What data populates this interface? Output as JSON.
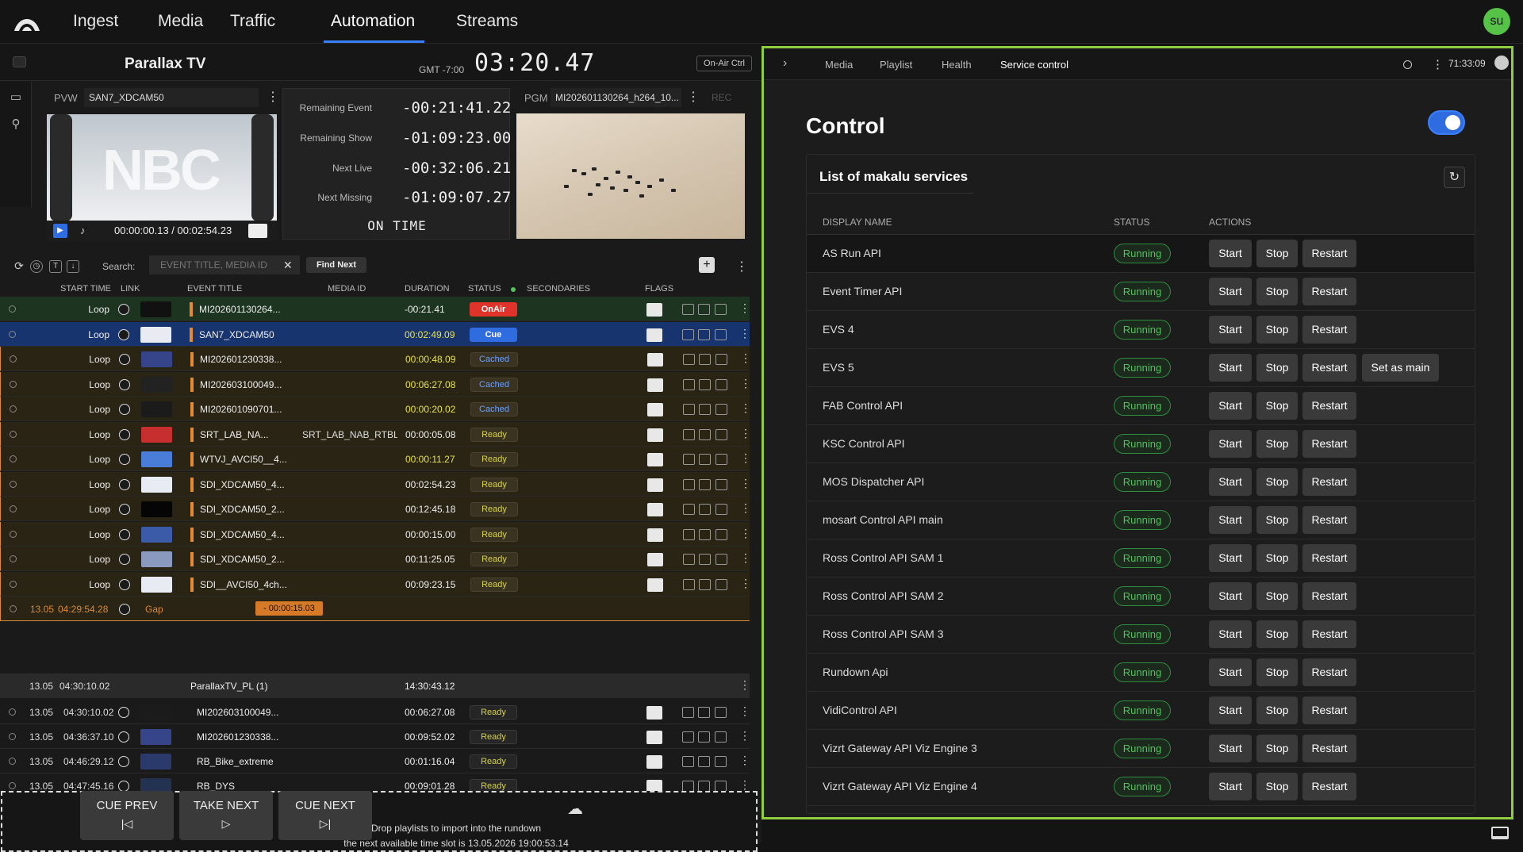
{
  "nav": {
    "tabs": [
      "Ingest",
      "Media",
      "Traffic",
      "Automation",
      "Streams"
    ],
    "active": "Automation",
    "user_initials": "su"
  },
  "channel": {
    "name": "Parallax TV",
    "timezone": "GMT -7:00",
    "clock": "03:20.47",
    "onair_ctrl": "On-Air Ctrl"
  },
  "preview": {
    "label": "PVW",
    "clip": "SAN7_XDCAM50",
    "time": "00:00:00.13 / 00:02:54.23"
  },
  "counters": {
    "remaining_event_label": "Remaining Event",
    "remaining_event": "-00:21:41.22",
    "remaining_show_label": "Remaining Show",
    "remaining_show": "-01:09:23.00",
    "next_live_label": "Next Live",
    "next_live": "-00:32:06.21",
    "next_missing_label": "Next Missing",
    "next_missing": "-01:09:07.27",
    "status": "ON TIME"
  },
  "program": {
    "label": "PGM",
    "clip": "MI202601130264_h264_10...",
    "rec": "REC"
  },
  "toolbar": {
    "search_label": "Search:",
    "search_placeholder": "EVENT TITLE, MEDIA ID",
    "find_next": "Find Next",
    "add": "+"
  },
  "columns": {
    "start_time": "START TIME",
    "link": "LINK",
    "event_title": "EVENT TITLE",
    "media_id": "MEDIA ID",
    "duration": "DURATION",
    "status": "STATUS",
    "secondaries": "SECONDARIES",
    "flags": "FLAGS"
  },
  "rundown": [
    {
      "start": "Loop",
      "title": "MI202601130264...",
      "media": "",
      "duration": "-00:21.41",
      "status": "OnAir"
    },
    {
      "start": "Loop",
      "title": "SAN7_XDCAM50",
      "media": "",
      "duration": "00:02:49.09",
      "status": "Cue"
    },
    {
      "start": "Loop",
      "title": "MI202601230338...",
      "media": "",
      "duration": "00:00:48.09",
      "status": "Cached"
    },
    {
      "start": "Loop",
      "title": "MI202603100049...",
      "media": "",
      "duration": "00:06:27.08",
      "status": "Cached"
    },
    {
      "start": "Loop",
      "title": "MI202601090701...",
      "media": "",
      "duration": "00:00:20.02",
      "status": "Cached"
    },
    {
      "start": "Loop",
      "title": "SRT_LAB_NA...",
      "media": "SRT_LAB_NAB_RTBL...",
      "duration": "00:00:05.08",
      "status": "Ready"
    },
    {
      "start": "Loop",
      "title": "WTVJ_AVCI50__4...",
      "media": "",
      "duration": "00:00:11.27",
      "status": "Ready"
    },
    {
      "start": "Loop",
      "title": "SDI_XDCAM50_4...",
      "media": "",
      "duration": "00:02:54.23",
      "status": "Ready"
    },
    {
      "start": "Loop",
      "title": "SDI_XDCAM50_2...",
      "media": "",
      "duration": "00:12:45.18",
      "status": "Ready"
    },
    {
      "start": "Loop",
      "title": "SDI_XDCAM50_4...",
      "media": "",
      "duration": "00:00:15.00",
      "status": "Ready"
    },
    {
      "start": "Loop",
      "title": "SDI_XDCAM50_2...",
      "media": "",
      "duration": "00:11:25.05",
      "status": "Ready"
    },
    {
      "start": "Loop",
      "title": "SDI__AVCI50_4ch...",
      "media": "",
      "duration": "00:09:23.15",
      "status": "Ready"
    }
  ],
  "gap": {
    "date": "13.05",
    "start": "04:29:54.28",
    "label": "Gap",
    "duration": "- 00:00:15.03"
  },
  "playlist": {
    "date": "13.05",
    "start": "04:30:10.02",
    "title": "ParallaxTV_PL (1)",
    "duration": "14:30:43.12"
  },
  "playlist_rows": [
    {
      "date": "13.05",
      "start": "04:30:10.02",
      "title": "MI202603100049...",
      "duration": "00:06:27.08",
      "status": "Ready"
    },
    {
      "date": "13.05",
      "start": "04:36:37.10",
      "title": "MI202601230338...",
      "duration": "00:09:52.02",
      "status": "Ready"
    },
    {
      "date": "13.05",
      "start": "04:46:29.12",
      "title": "RB_Bike_extreme",
      "duration": "00:01:16.04",
      "status": "Ready"
    },
    {
      "date": "13.05",
      "start": "04:47:45.16",
      "title": "RB_DYS",
      "duration": "00:09:01.28",
      "status": "Ready"
    }
  ],
  "dropzone": {
    "line1": "Drop playlists to import into the rundown",
    "line2": "the next available time slot is 13.05.2026 19:00:53.14"
  },
  "actions": {
    "cue_prev": "CUE PREV",
    "take_next": "TAKE NEXT",
    "cue_next": "CUE NEXT"
  },
  "right_panel": {
    "tabs": [
      "Media",
      "Playlist",
      "Health",
      "Service control"
    ],
    "active_tab": "Service control",
    "clock": "71:33:09",
    "title": "Control",
    "list_title": "List of makalu services",
    "headers": {
      "name": "DISPLAY NAME",
      "status": "STATUS",
      "actions": "ACTIONS"
    },
    "btn_start": "Start",
    "btn_stop": "Stop",
    "btn_restart": "Restart",
    "btn_set_main": "Set as main",
    "services": [
      {
        "name": "AS Run API",
        "status": "Running"
      },
      {
        "name": "Event Timer API",
        "status": "Running"
      },
      {
        "name": "EVS 4",
        "status": "Running"
      },
      {
        "name": "EVS 5",
        "status": "Running",
        "set_main": true
      },
      {
        "name": "FAB Control API",
        "status": "Running"
      },
      {
        "name": "KSC Control API",
        "status": "Running"
      },
      {
        "name": "MOS Dispatcher API",
        "status": "Running"
      },
      {
        "name": "mosart Control API main",
        "status": "Running"
      },
      {
        "name": "Ross Control API SAM 1",
        "status": "Running"
      },
      {
        "name": "Ross Control API SAM 2",
        "status": "Running"
      },
      {
        "name": "Ross Control API SAM 3",
        "status": "Running"
      },
      {
        "name": "Rundown Api",
        "status": "Running"
      },
      {
        "name": "VidiControl API",
        "status": "Running"
      },
      {
        "name": "Vizrt Gateway API Viz Engine 3",
        "status": "Running"
      },
      {
        "name": "Vizrt Gateway API Viz Engine 4",
        "status": "Running"
      }
    ]
  },
  "colors": {
    "accent": "#3a7fff",
    "panel_border": "#8fce3e",
    "onair": "#e0342a",
    "cue": "#2f6ce0",
    "running": "#52c15f"
  }
}
